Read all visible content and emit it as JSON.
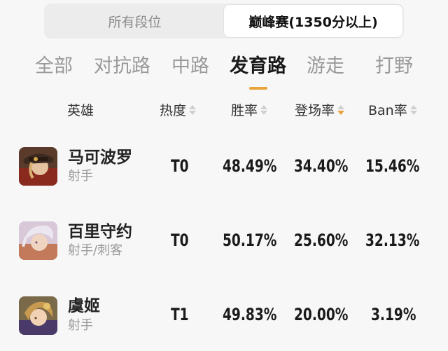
{
  "segments": [
    {
      "label": "所有段位",
      "active": false
    },
    {
      "label": "巅峰赛(1350分以上)",
      "active": true
    }
  ],
  "tabs": [
    "全部",
    "对抗路",
    "中路",
    "发育路",
    "游走",
    "打野"
  ],
  "active_tab": "发育路",
  "accent_color": "#e8a33a",
  "headers": {
    "hero": "英雄",
    "heat": "热度",
    "win": "胜率",
    "pick": "登场率",
    "ban": "Ban率"
  },
  "rows": [
    {
      "name": "马可波罗",
      "role": "射手",
      "tier": "T0",
      "win": "48.49%",
      "pick": "34.40%",
      "ban": "15.46%"
    },
    {
      "name": "百里守约",
      "role": "射手/刺客",
      "tier": "T0",
      "win": "50.17%",
      "pick": "25.60%",
      "ban": "32.13%"
    },
    {
      "name": "虞姬",
      "role": "射手",
      "tier": "T1",
      "win": "49.83%",
      "pick": "20.00%",
      "ban": "3.19%"
    }
  ]
}
